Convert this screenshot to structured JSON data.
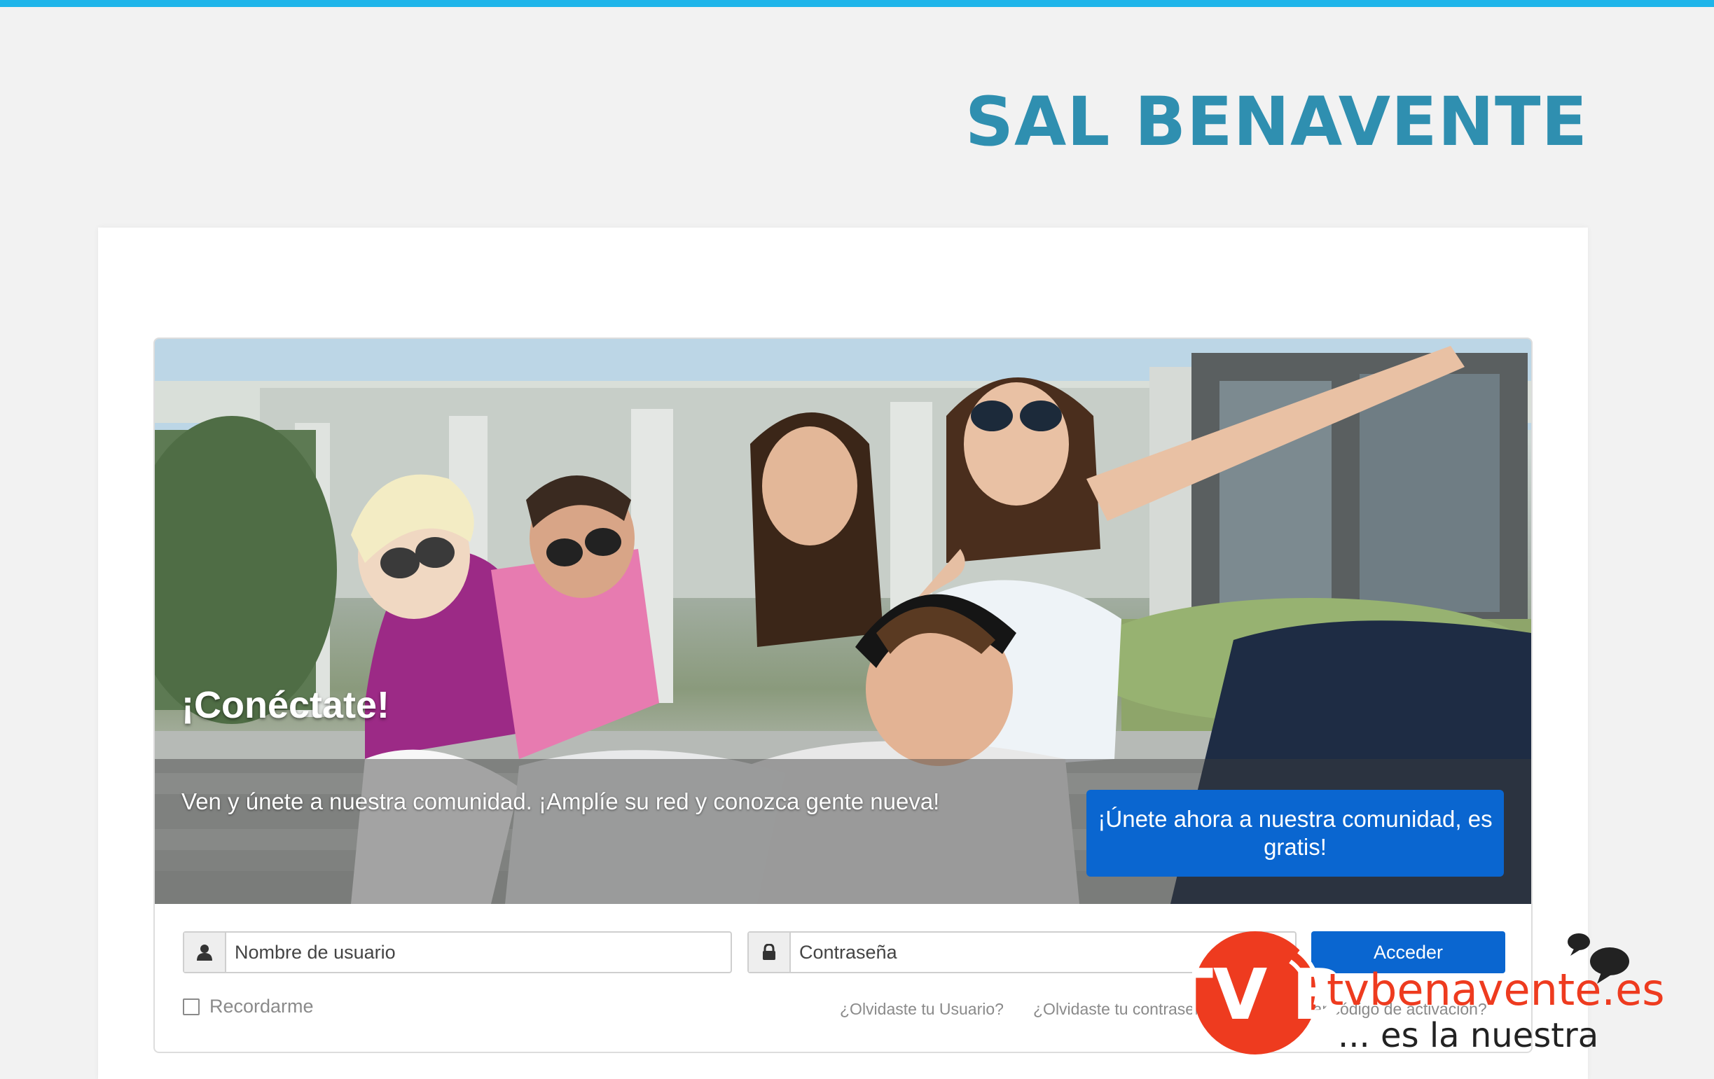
{
  "colors": {
    "top_bar": "#1fb5ea",
    "title": "#2f8fb0",
    "primary_button": "#0a66d0",
    "background": "#f2f2f2"
  },
  "header": {
    "site_title": "SAL BENAVENTE"
  },
  "hero": {
    "title": "¡Conéctate!",
    "text": "Ven y únete a nuestra comunidad. ¡Amplíe su red y conozca gente nueva!",
    "join_button": "¡Únete ahora a nuestra comunidad, es gratis!"
  },
  "login": {
    "username_placeholder": "Nombre de usuario",
    "password_placeholder": "Contraseña",
    "submit_label": "Acceder",
    "remember_label": "Recordarme",
    "forgot_username": "¿Olvidaste tu Usuario?",
    "forgot_password": "¿Olvidaste tu contraseña?",
    "activation_code": "¿Reenviar código de activación?",
    "user_icon": "user-icon",
    "lock_icon": "lock-icon"
  },
  "watermark": {
    "logo_text": "TV B",
    "brand": "tvbenavente.es",
    "tagline": "... es la nuestra"
  }
}
